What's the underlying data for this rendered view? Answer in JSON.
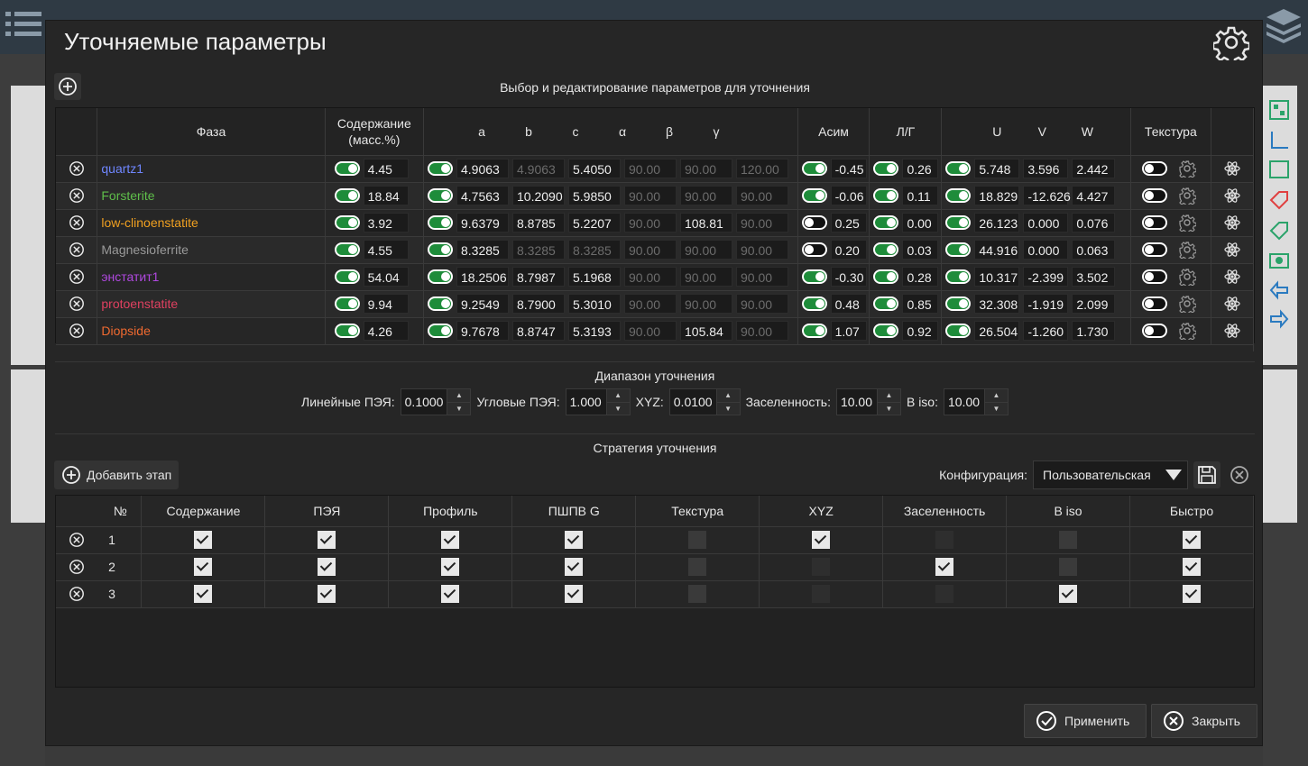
{
  "dialog": {
    "title": "Уточняемые параметры",
    "subtitle": "Выбор и редактирование параметров для уточнения"
  },
  "phase_table": {
    "headers": {
      "phase": "Фаза",
      "content": "Содержание (масс.%)",
      "a": "a",
      "b": "b",
      "c": "c",
      "alpha": "α",
      "beta": "β",
      "gamma": "γ",
      "asym": "Асим",
      "lg": "Л/Г",
      "u": "U",
      "v": "V",
      "w": "W",
      "texture": "Текстура"
    },
    "rows": [
      {
        "name": "quartz1",
        "color": "#6f86ff",
        "content_on": true,
        "content": "4.45",
        "cell_on": true,
        "a": "4.9063",
        "b": "4.9063",
        "c": "5.4050",
        "alpha": "90.00",
        "beta": "90.00",
        "gamma": "120.00",
        "b_dis": true,
        "c_dis": false,
        "beta_dis": true,
        "asym_on": true,
        "asym": "-0.45",
        "lg_on": true,
        "lg": "0.26",
        "uvw_on": true,
        "u": "5.748",
        "v": "3.596",
        "w": "2.442",
        "tex_on": false
      },
      {
        "name": "Forsterite",
        "color": "#5fbf4a",
        "content_on": true,
        "content": "18.84",
        "cell_on": true,
        "a": "4.7563",
        "b": "10.2090",
        "c": "5.9850",
        "alpha": "90.00",
        "beta": "90.00",
        "gamma": "90.00",
        "b_dis": false,
        "c_dis": false,
        "beta_dis": true,
        "asym_on": true,
        "asym": "-0.06",
        "lg_on": true,
        "lg": "0.11",
        "uvw_on": true,
        "u": "18.829",
        "v": "-12.626",
        "w": "4.427",
        "tex_on": false
      },
      {
        "name": "low-clinoenstatite",
        "color": "#f0a020",
        "content_on": true,
        "content": "3.92",
        "cell_on": true,
        "a": "9.6379",
        "b": "8.8785",
        "c": "5.2207",
        "alpha": "90.00",
        "beta": "108.81",
        "gamma": "90.00",
        "b_dis": false,
        "c_dis": false,
        "beta_dis": false,
        "asym_on": false,
        "asym": "0.25",
        "lg_on": true,
        "lg": "0.00",
        "uvw_on": true,
        "u": "26.123",
        "v": "0.000",
        "w": "0.076",
        "tex_on": false
      },
      {
        "name": "Magnesioferrite",
        "color": "#9a9a9a",
        "content_on": true,
        "content": "4.55",
        "cell_on": true,
        "a": "8.3285",
        "b": "8.3285",
        "c": "8.3285",
        "alpha": "90.00",
        "beta": "90.00",
        "gamma": "90.00",
        "b_dis": true,
        "c_dis": true,
        "beta_dis": true,
        "asym_on": false,
        "asym": "0.20",
        "lg_on": true,
        "lg": "0.03",
        "uvw_on": true,
        "u": "44.916",
        "v": "0.000",
        "w": "0.063",
        "tex_on": false
      },
      {
        "name": "энстатит1",
        "color": "#b048e0",
        "content_on": true,
        "content": "54.04",
        "cell_on": true,
        "a": "18.2506",
        "b": "8.7987",
        "c": "5.1968",
        "alpha": "90.00",
        "beta": "90.00",
        "gamma": "90.00",
        "b_dis": false,
        "c_dis": false,
        "beta_dis": true,
        "asym_on": true,
        "asym": "-0.30",
        "lg_on": true,
        "lg": "0.28",
        "uvw_on": true,
        "u": "10.317",
        "v": "-2.399",
        "w": "3.502",
        "tex_on": false
      },
      {
        "name": "protoenstatite",
        "color": "#e04060",
        "content_on": true,
        "content": "9.94",
        "cell_on": true,
        "a": "9.2549",
        "b": "8.7900",
        "c": "5.3010",
        "alpha": "90.00",
        "beta": "90.00",
        "gamma": "90.00",
        "b_dis": false,
        "c_dis": false,
        "beta_dis": true,
        "asym_on": true,
        "asym": "0.48",
        "lg_on": true,
        "lg": "0.85",
        "uvw_on": true,
        "u": "32.308",
        "v": "-1.919",
        "w": "2.099",
        "tex_on": false
      },
      {
        "name": "Diopside",
        "color": "#f06a30",
        "content_on": true,
        "content": "4.26",
        "cell_on": true,
        "a": "9.7678",
        "b": "8.8747",
        "c": "5.3193",
        "alpha": "90.00",
        "beta": "105.84",
        "gamma": "90.00",
        "b_dis": false,
        "c_dis": false,
        "beta_dis": false,
        "asym_on": true,
        "asym": "1.07",
        "lg_on": true,
        "lg": "0.92",
        "uvw_on": true,
        "u": "26.504",
        "v": "-1.260",
        "w": "1.730",
        "tex_on": false
      }
    ]
  },
  "range": {
    "title": "Диапазон уточнения",
    "linear_label": "Линейные ПЭЯ:",
    "linear": "0.1000",
    "angular_label": "Угловые ПЭЯ:",
    "angular": "1.000",
    "xyz_label": "XYZ:",
    "xyz": "0.0100",
    "occupancy_label": "Заселенность:",
    "occupancy": "10.00",
    "biso_label": "B iso:",
    "biso": "10.00"
  },
  "strategy": {
    "title": "Стратегия уточнения",
    "add_stage": "Добавить этап",
    "config_label": "Конфигурация:",
    "config_value": "Пользовательская",
    "headers": [
      "№",
      "Содержание",
      "ПЭЯ",
      "Профиль",
      "ПШПВ G",
      "Текстура",
      "XYZ",
      "Заселенность",
      "B iso",
      "Быстро"
    ],
    "rows": [
      {
        "n": "1",
        "checks": [
          true,
          true,
          true,
          true,
          false,
          true,
          false,
          false,
          true
        ]
      },
      {
        "n": "2",
        "checks": [
          true,
          true,
          true,
          true,
          false,
          false,
          true,
          false,
          true
        ]
      },
      {
        "n": "3",
        "checks": [
          true,
          true,
          true,
          true,
          false,
          false,
          false,
          true,
          true
        ]
      }
    ]
  },
  "footer": {
    "apply": "Применить",
    "close": "Закрыть"
  },
  "colors": {
    "accent_on": "#1e8c3a",
    "dialog_bg": "#262626"
  }
}
